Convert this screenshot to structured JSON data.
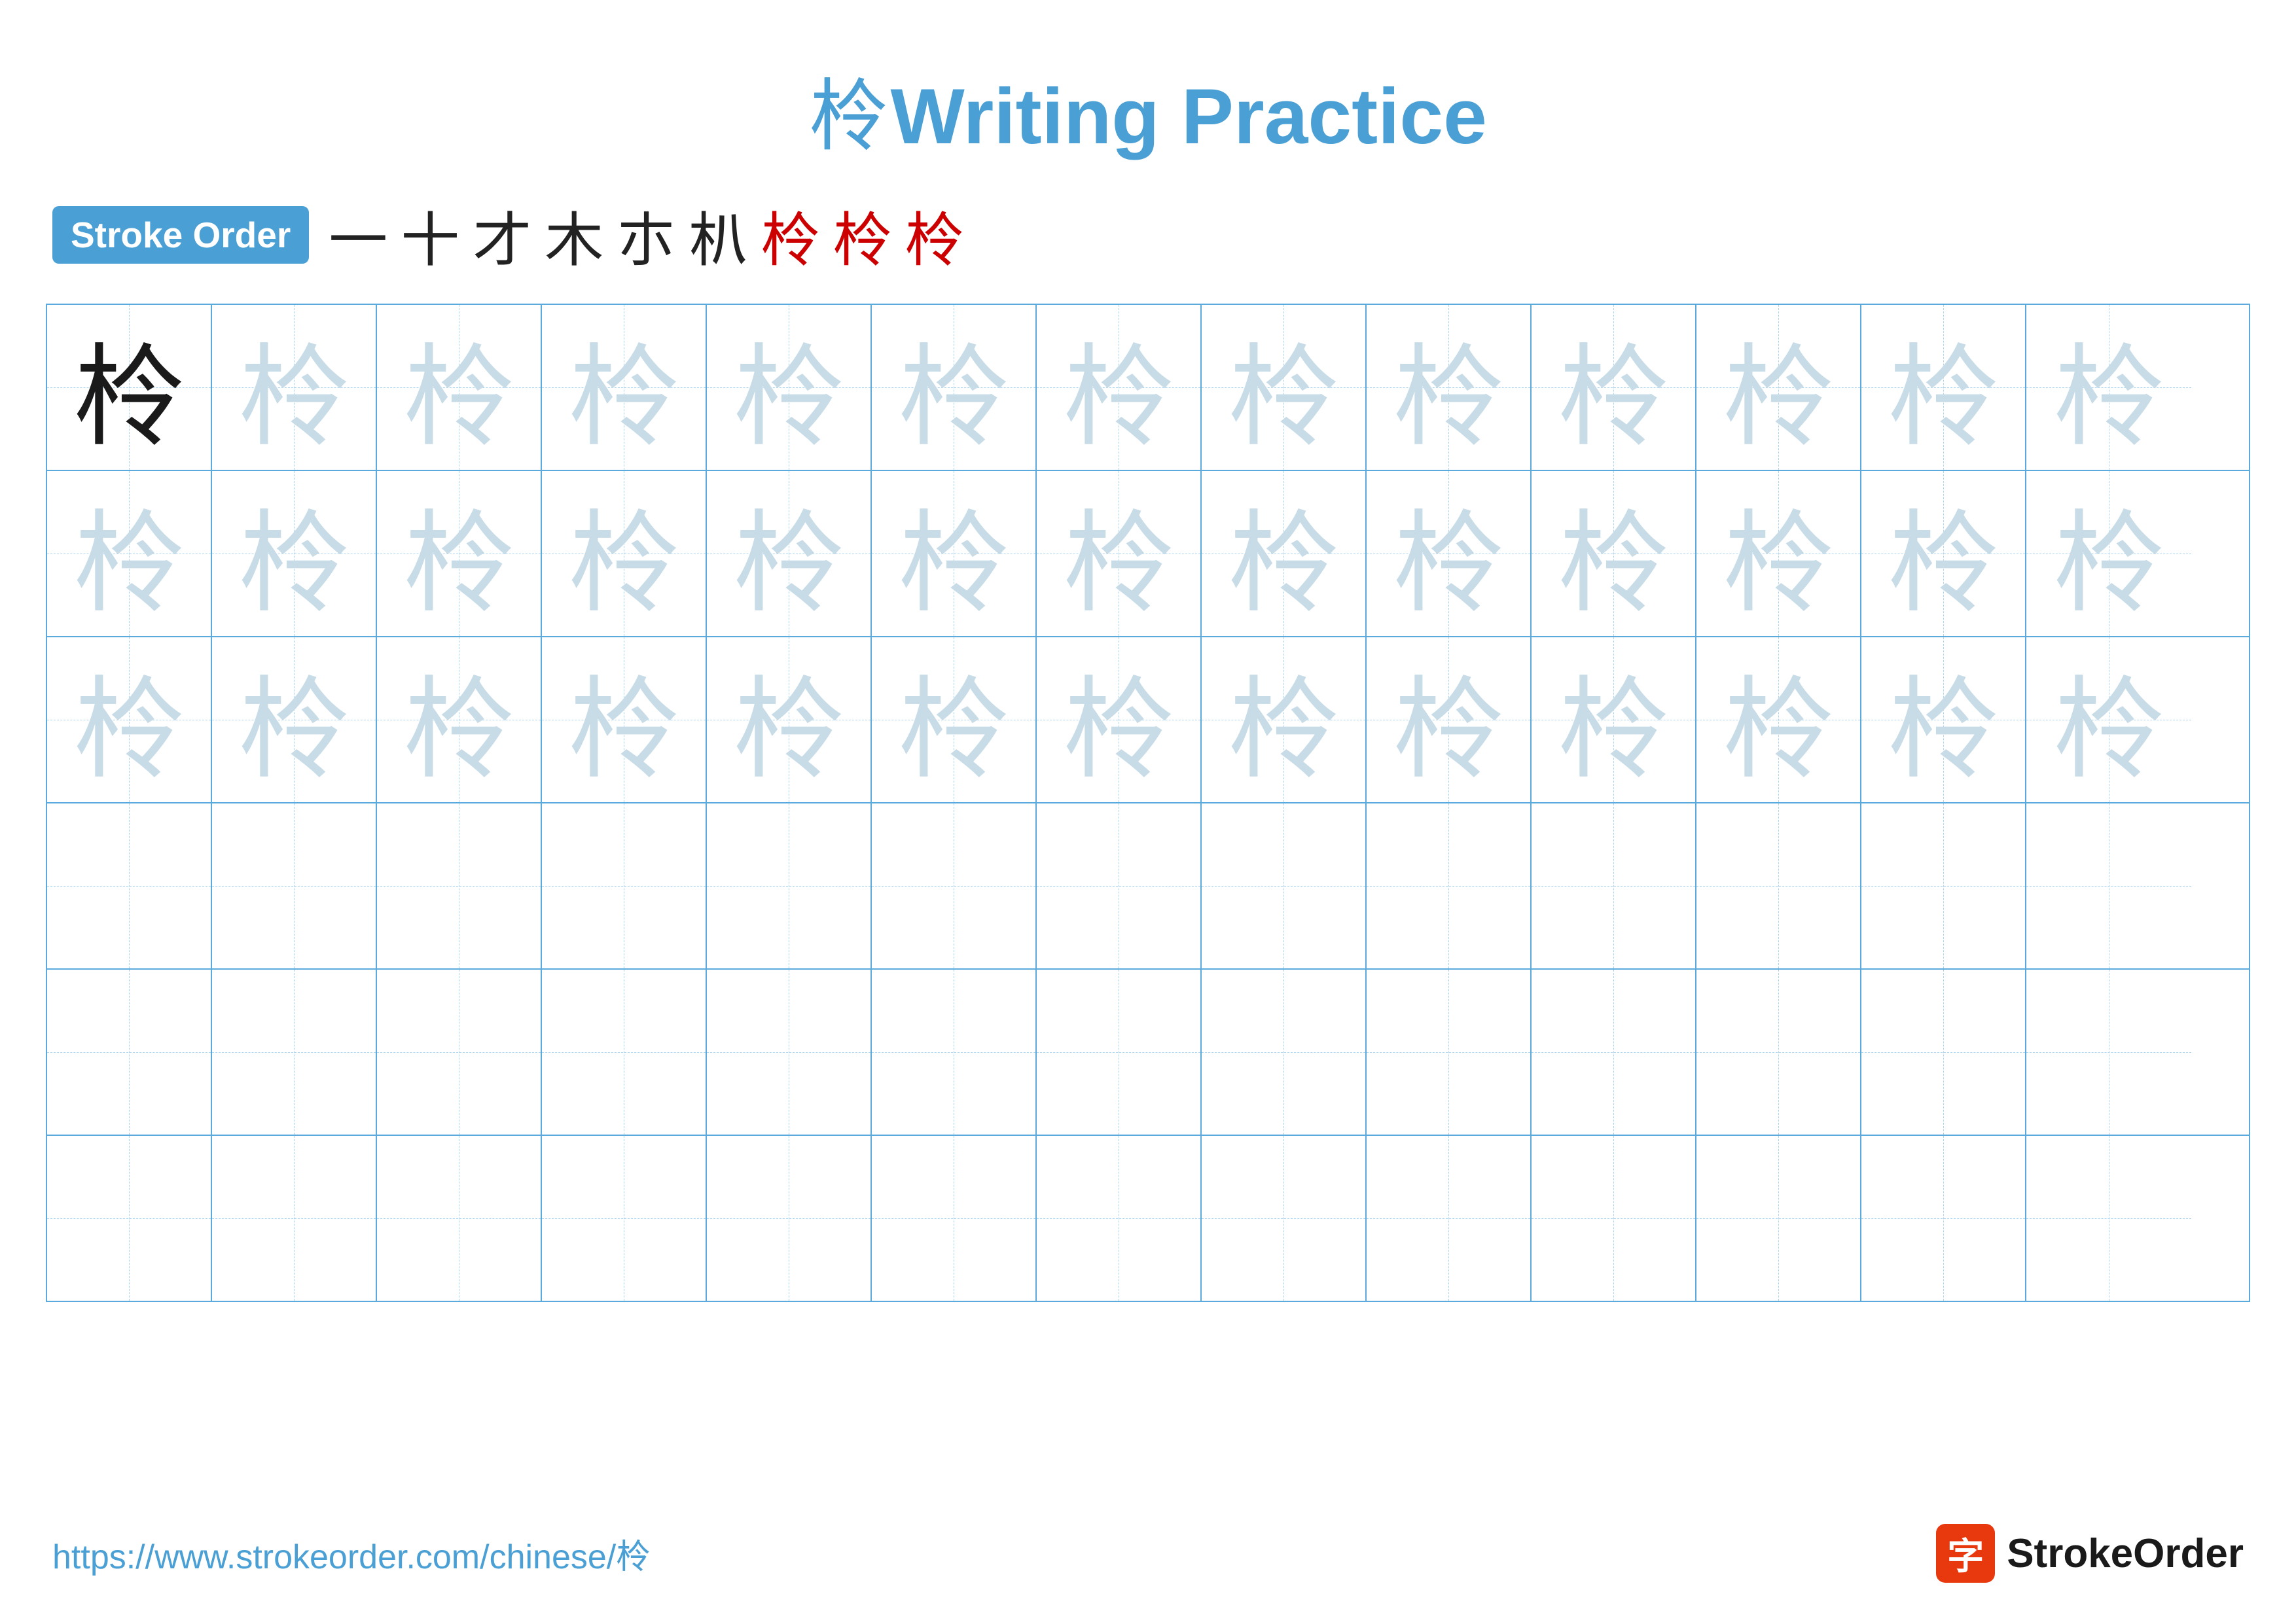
{
  "header": {
    "chinese_char": "柃",
    "title_prefix": "柃",
    "title_suffix": "Writing Practice"
  },
  "stroke_order": {
    "badge_label": "Stroke Order",
    "strokes": [
      "一",
      "十",
      "才",
      "木",
      "朩",
      "朳",
      "柃",
      "柃",
      "柃"
    ]
  },
  "grid": {
    "rows": 6,
    "cols": 13,
    "char": "柃"
  },
  "footer": {
    "url": "https://www.strokeorder.com/chinese/柃",
    "logo_char": "字",
    "logo_text": "StrokeOrder"
  }
}
